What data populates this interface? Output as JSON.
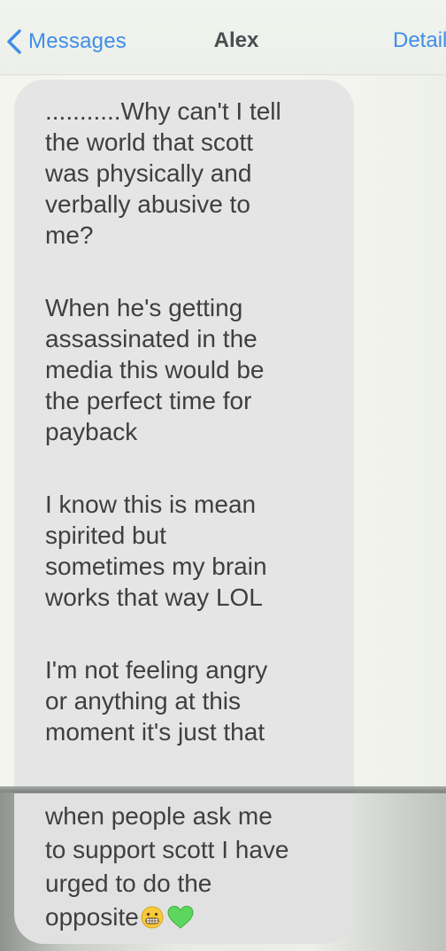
{
  "nav": {
    "back_label": "Messages",
    "contact_name": "Alex",
    "details_label": "Details"
  },
  "message": {
    "lines_top": [
      "...........Why can't I tell",
      "the world that scott",
      "was physically and",
      "verbally abusive to",
      "me?",
      "",
      "When he's getting",
      "assassinated in the",
      "media this would be",
      "the perfect time for",
      "payback",
      "",
      "I know this is mean",
      "spirited but",
      "sometimes my brain",
      "works that way LOL",
      "",
      "I'm not feeling angry",
      "or anything at this",
      "moment it's just that"
    ],
    "lines_bottom": [
      "when people ask me",
      "to support scott I have",
      "urged to do the",
      "opposite"
    ],
    "emoji": [
      "grimacing-face-icon",
      "green-heart-icon"
    ]
  },
  "colors": {
    "accent": "#3f8ee8",
    "bubble": "#e5e5e5",
    "text": "#3f3f3f",
    "heart": "#5cd65c",
    "face": "#f7c93b"
  }
}
